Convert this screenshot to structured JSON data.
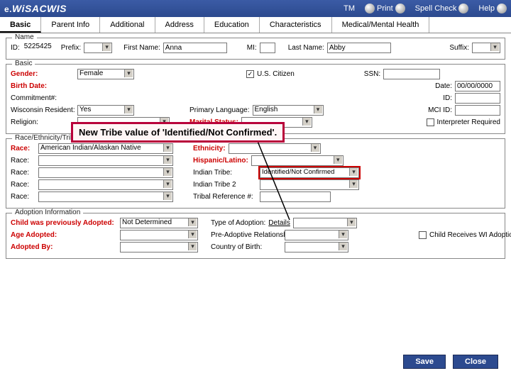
{
  "header": {
    "logo_prefix": "e.",
    "logo_main": "WiSACWIS",
    "tools": {
      "tm": "TM",
      "print": "Print",
      "spell": "Spell Check",
      "help": "Help"
    }
  },
  "tabs": [
    "Basic",
    "Parent Info",
    "Additional",
    "Address",
    "Education",
    "Characteristics",
    "Medical/Mental Health"
  ],
  "active_tab": 0,
  "groups": {
    "name": {
      "title": "Name",
      "id_lbl": "ID:",
      "id_val": "5225425",
      "prefix_lbl": "Prefix:",
      "prefix_val": "",
      "first_lbl": "First Name:",
      "first_val": "Anna",
      "mi_lbl": "MI:",
      "mi_val": "",
      "last_lbl": "Last Name:",
      "last_val": "Abby",
      "suffix_lbl": "Suffix:",
      "suffix_val": ""
    },
    "basic": {
      "title": "Basic",
      "gender_lbl": "Gender:",
      "gender_val": "Female",
      "citizen_lbl": "U.S. Citizen",
      "ssn_lbl": "SSN:",
      "birth_lbl": "Birth Date:",
      "ddate_lbl": "Date:",
      "ddate_val": "00/00/0000",
      "commit_lbl": "Commitment#:",
      "id2_lbl": "ID:",
      "wisres_lbl": "Wisconsin Resident:",
      "wisres_val": "Yes",
      "plang_lbl": "Primary Language:",
      "plang_val": "English",
      "mci_lbl": "MCI ID:",
      "religion_lbl": "Religion:",
      "marital_lbl": "Marital Status:",
      "interp_lbl": "Interpreter Required"
    },
    "race": {
      "title": "Race/Ethnicity/Tribal Identification",
      "race_lbl": "Race:",
      "race1_val": "American Indian/Alaskan Native",
      "eth_lbl": "Ethnicity:",
      "hisp_lbl": "Hispanic/Latino:",
      "tribe_lbl": "Indian Tribe:",
      "tribe_val": "Identified/Not Confirmed",
      "tribe2_lbl": "Indian Tribe 2",
      "tribref_lbl": "Tribal Reference #:"
    },
    "adopt": {
      "title": "Adoption Information",
      "prev_lbl": "Child was previously Adopted:",
      "prev_val": "Not Determined",
      "type_lbl": "Type of Adoption:",
      "details_lbl": "Details",
      "age_lbl": "Age Adopted:",
      "preadopt_lbl": "Pre-Adoptive Relationship to Child:",
      "by_lbl": "Adopted By:",
      "country_lbl": "Country of Birth:",
      "assist_lbl": "Child Receives WI Adoption Assistance"
    }
  },
  "callout_text": "New Tribe value of 'Identified/Not Confirmed'.",
  "buttons": {
    "save": "Save",
    "close": "Close"
  }
}
